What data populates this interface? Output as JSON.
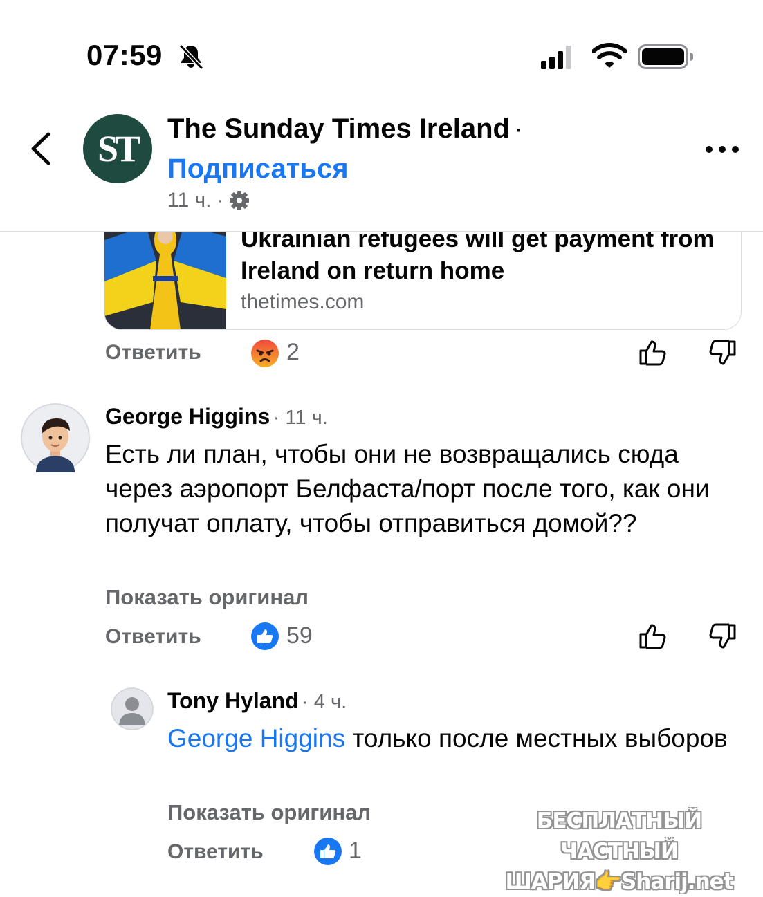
{
  "status_bar": {
    "time": "07:59"
  },
  "header": {
    "page_name": "The Sunday Times Ireland",
    "separator": "·",
    "follow_label": "Подписаться",
    "post_time": "11 ч.",
    "meta_dot": "·",
    "logo_text": "ST"
  },
  "link_preview": {
    "title": "Ukrainian refugees will get payment from Ireland on return home",
    "domain": "thetimes.com"
  },
  "post_actions": {
    "reply_label": "Ответить",
    "reaction_count": "2"
  },
  "comments": [
    {
      "author": "George Higgins",
      "time": "· 11 ч.",
      "text": "Есть ли план, чтобы они не возвращались сюда через аэропорт Белфаста/порт после того, как они получат оплату, чтобы отправиться домой??",
      "show_original": "Показать оригинал",
      "reply_label": "Ответить",
      "reaction_count": "59"
    },
    {
      "author": "Tony Hyland",
      "time": "· 4 ч.",
      "mention": "George Higgins",
      "text": " только после местных выборов",
      "show_original": "Показать оригинал",
      "reply_label": "Ответить",
      "reaction_count": "1"
    }
  ],
  "watermark": {
    "line1": "БЕСПЛАТНЫЙ ЧАСТНЫЙ",
    "line2": "ШАРИЯ👉Sharij.net"
  },
  "colors": {
    "accent": "#1877f2",
    "secondary_text": "#65676b",
    "logo_bg": "#1f4a3f"
  }
}
